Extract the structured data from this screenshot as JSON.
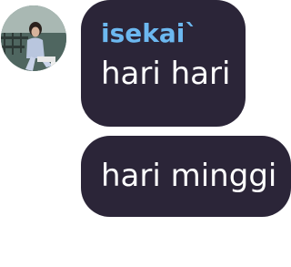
{
  "messages": [
    {
      "sender": "isekai`",
      "text": "hari hari"
    },
    {
      "text": "hari minggi"
    }
  ],
  "colors": {
    "bubble_background": "#2b2538",
    "sender_name": "#6cb8f0",
    "message_text": "#ffffff"
  },
  "icons": {
    "avatar": "user-profile-photo"
  }
}
